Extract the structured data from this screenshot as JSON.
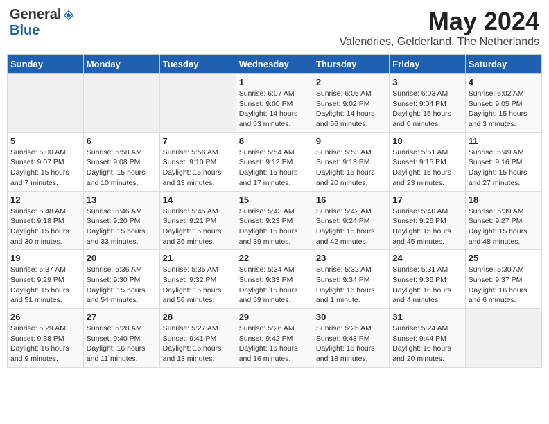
{
  "header": {
    "logo_general": "General",
    "logo_blue": "Blue",
    "month_year": "May 2024",
    "location": "Valendries, Gelderland, The Netherlands"
  },
  "days_of_week": [
    "Sunday",
    "Monday",
    "Tuesday",
    "Wednesday",
    "Thursday",
    "Friday",
    "Saturday"
  ],
  "weeks": [
    [
      {
        "day": "",
        "info": ""
      },
      {
        "day": "",
        "info": ""
      },
      {
        "day": "",
        "info": ""
      },
      {
        "day": "1",
        "info": "Sunrise: 6:07 AM\nSunset: 9:00 PM\nDaylight: 14 hours and 53 minutes."
      },
      {
        "day": "2",
        "info": "Sunrise: 6:05 AM\nSunset: 9:02 PM\nDaylight: 14 hours and 56 minutes."
      },
      {
        "day": "3",
        "info": "Sunrise: 6:03 AM\nSunset: 9:04 PM\nDaylight: 15 hours and 0 minutes."
      },
      {
        "day": "4",
        "info": "Sunrise: 6:02 AM\nSunset: 9:05 PM\nDaylight: 15 hours and 3 minutes."
      }
    ],
    [
      {
        "day": "5",
        "info": "Sunrise: 6:00 AM\nSunset: 9:07 PM\nDaylight: 15 hours and 7 minutes."
      },
      {
        "day": "6",
        "info": "Sunrise: 5:58 AM\nSunset: 9:08 PM\nDaylight: 15 hours and 10 minutes."
      },
      {
        "day": "7",
        "info": "Sunrise: 5:56 AM\nSunset: 9:10 PM\nDaylight: 15 hours and 13 minutes."
      },
      {
        "day": "8",
        "info": "Sunrise: 5:54 AM\nSunset: 9:12 PM\nDaylight: 15 hours and 17 minutes."
      },
      {
        "day": "9",
        "info": "Sunrise: 5:53 AM\nSunset: 9:13 PM\nDaylight: 15 hours and 20 minutes."
      },
      {
        "day": "10",
        "info": "Sunrise: 5:51 AM\nSunset: 9:15 PM\nDaylight: 15 hours and 23 minutes."
      },
      {
        "day": "11",
        "info": "Sunrise: 5:49 AM\nSunset: 9:16 PM\nDaylight: 15 hours and 27 minutes."
      }
    ],
    [
      {
        "day": "12",
        "info": "Sunrise: 5:48 AM\nSunset: 9:18 PM\nDaylight: 15 hours and 30 minutes."
      },
      {
        "day": "13",
        "info": "Sunrise: 5:46 AM\nSunset: 9:20 PM\nDaylight: 15 hours and 33 minutes."
      },
      {
        "day": "14",
        "info": "Sunrise: 5:45 AM\nSunset: 9:21 PM\nDaylight: 15 hours and 36 minutes."
      },
      {
        "day": "15",
        "info": "Sunrise: 5:43 AM\nSunset: 9:23 PM\nDaylight: 15 hours and 39 minutes."
      },
      {
        "day": "16",
        "info": "Sunrise: 5:42 AM\nSunset: 9:24 PM\nDaylight: 15 hours and 42 minutes."
      },
      {
        "day": "17",
        "info": "Sunrise: 5:40 AM\nSunset: 9:26 PM\nDaylight: 15 hours and 45 minutes."
      },
      {
        "day": "18",
        "info": "Sunrise: 5:39 AM\nSunset: 9:27 PM\nDaylight: 15 hours and 48 minutes."
      }
    ],
    [
      {
        "day": "19",
        "info": "Sunrise: 5:37 AM\nSunset: 9:29 PM\nDaylight: 15 hours and 51 minutes."
      },
      {
        "day": "20",
        "info": "Sunrise: 5:36 AM\nSunset: 9:30 PM\nDaylight: 15 hours and 54 minutes."
      },
      {
        "day": "21",
        "info": "Sunrise: 5:35 AM\nSunset: 9:32 PM\nDaylight: 15 hours and 56 minutes."
      },
      {
        "day": "22",
        "info": "Sunrise: 5:34 AM\nSunset: 9:33 PM\nDaylight: 15 hours and 59 minutes."
      },
      {
        "day": "23",
        "info": "Sunrise: 5:32 AM\nSunset: 9:34 PM\nDaylight: 16 hours and 1 minute."
      },
      {
        "day": "24",
        "info": "Sunrise: 5:31 AM\nSunset: 9:36 PM\nDaylight: 16 hours and 4 minutes."
      },
      {
        "day": "25",
        "info": "Sunrise: 5:30 AM\nSunset: 9:37 PM\nDaylight: 16 hours and 6 minutes."
      }
    ],
    [
      {
        "day": "26",
        "info": "Sunrise: 5:29 AM\nSunset: 9:38 PM\nDaylight: 16 hours and 9 minutes."
      },
      {
        "day": "27",
        "info": "Sunrise: 5:28 AM\nSunset: 9:40 PM\nDaylight: 16 hours and 11 minutes."
      },
      {
        "day": "28",
        "info": "Sunrise: 5:27 AM\nSunset: 9:41 PM\nDaylight: 16 hours and 13 minutes."
      },
      {
        "day": "29",
        "info": "Sunrise: 5:26 AM\nSunset: 9:42 PM\nDaylight: 16 hours and 16 minutes."
      },
      {
        "day": "30",
        "info": "Sunrise: 5:25 AM\nSunset: 9:43 PM\nDaylight: 16 hours and 18 minutes."
      },
      {
        "day": "31",
        "info": "Sunrise: 5:24 AM\nSunset: 9:44 PM\nDaylight: 16 hours and 20 minutes."
      },
      {
        "day": "",
        "info": ""
      }
    ]
  ]
}
